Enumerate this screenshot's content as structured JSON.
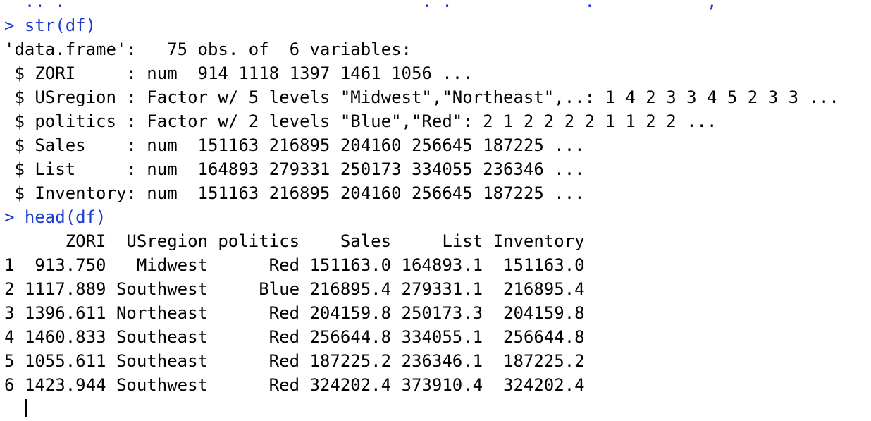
{
  "console": {
    "prompt_symbol": ">",
    "partial_top_line": "  .. .                                   . .             .           ,",
    "commands": [
      {
        "prompt": ">",
        "input": " str(df)",
        "output": [
          "'data.frame':   75 obs. of  6 variables:",
          " $ ZORI     : num  914 1118 1397 1461 1056 ...",
          " $ USregion : Factor w/ 5 levels \"Midwest\",\"Northeast\",..: 1 4 2 3 3 4 5 2 3 3 ...",
          " $ politics : Factor w/ 2 levels \"Blue\",\"Red\": 2 1 2 2 2 2 1 1 2 2 ...",
          " $ Sales    : num  151163 216895 204160 256645 187225 ...",
          " $ List     : num  164893 279331 250173 334055 236346 ...",
          " $ Inventory: num  151163 216895 204160 256645 187225 ..."
        ]
      },
      {
        "prompt": ">",
        "input": " head(df)",
        "output": [
          "      ZORI  USregion politics    Sales     List Inventory",
          "1  913.750   Midwest      Red 151163.0 164893.1  151163.0",
          "2 1117.889 Southwest     Blue 216895.4 279331.1  216895.4",
          "3 1396.611 Northeast      Red 204159.8 250173.3  204159.8",
          "4 1460.833 Southeast      Red 256644.8 334055.1  256644.8",
          "5 1055.611 Southeast      Red 187225.2 236346.1  187225.2",
          "6 1423.944 Southwest      Red 324202.4 373910.4  324202.4"
        ]
      }
    ]
  },
  "colors": {
    "command_text": "#1f3bd1",
    "output_text": "#000000",
    "background": "#ffffff"
  }
}
